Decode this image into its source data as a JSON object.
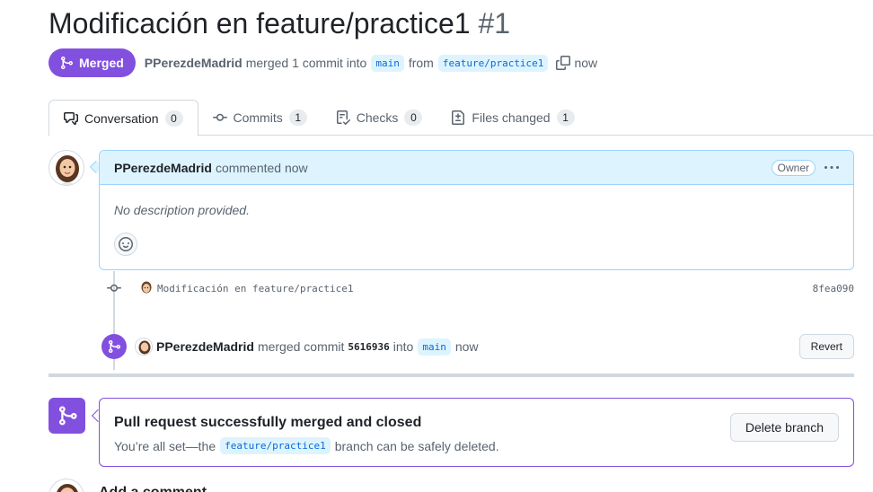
{
  "pr": {
    "title": "Modificación en feature/practice1",
    "number": "#1",
    "state": "Merged",
    "author": "PPerezdeMadrid",
    "merge_text": "merged 1 commit into",
    "base_branch": "main",
    "from_text": "from",
    "head_branch": "feature/practice1",
    "time": "now"
  },
  "tabs": [
    {
      "label": "Conversation",
      "count": "0"
    },
    {
      "label": "Commits",
      "count": "1"
    },
    {
      "label": "Checks",
      "count": "0"
    },
    {
      "label": "Files changed",
      "count": "1"
    }
  ],
  "comment": {
    "author": "PPerezdeMadrid",
    "action": "commented now",
    "role": "Owner",
    "body": "No description provided."
  },
  "commit": {
    "message": "Modificación en feature/practice1",
    "sha": "8fea090"
  },
  "merge_event": {
    "author": "PPerezdeMadrid",
    "text_before": "merged commit",
    "sha": "5616936",
    "text_into": "into",
    "branch": "main",
    "time": "now",
    "revert_label": "Revert"
  },
  "merged_box": {
    "title": "Pull request successfully merged and closed",
    "desc_before": "You’re all set—the",
    "branch": "feature/practice1",
    "desc_after": "branch can be safely deleted.",
    "delete_label": "Delete branch"
  },
  "add_comment": {
    "title": "Add a comment"
  },
  "colors": {
    "merged_purple": "#8250df",
    "accent_blue": "#0969da",
    "comment_header_bg": "#ddf4ff"
  }
}
